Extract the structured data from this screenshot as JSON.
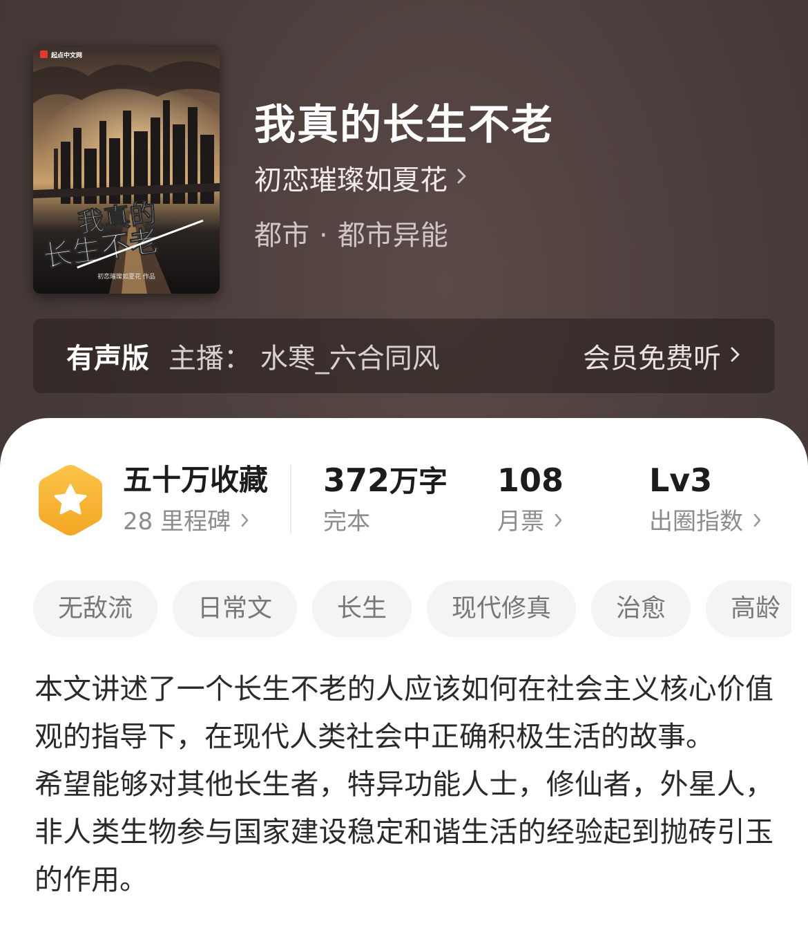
{
  "book": {
    "title": "我真的长生不老",
    "author": "初恋璀璨如夏花",
    "genre": "都市",
    "subgenre": "都市异能",
    "genre_separator": "·",
    "cover": {
      "publisher_logo_text": "起点中文网",
      "cover_title_line1": "我真的",
      "cover_title_line2": "长生不老",
      "cover_author_credit": "初恋璀璨如夏花  作品"
    }
  },
  "audio": {
    "label": "有声版",
    "narrator": "主播：  水寒_六合同风",
    "cta": "会员免费听"
  },
  "stats": {
    "favorites": {
      "value": "五十万收藏",
      "label": "28 里程碑"
    },
    "words": {
      "value_number": "372",
      "value_unit": "万字",
      "label": "完本"
    },
    "monthly_tickets": {
      "value": "108",
      "label": "月票"
    },
    "index": {
      "value": "Lv3",
      "label": "出圈指数"
    }
  },
  "tags": [
    "无敌流",
    "日常文",
    "长生",
    "现代修真",
    "治愈",
    "高龄"
  ],
  "synopsis": [
    "本文讲述了一个长生不老的人应该如何在社会主义核心价值观的指导下，在现代人类社会中正确积极生活的故事。",
    "希望能够对其他长生者，特异功能人士，修仙者，外星人，非人类生物参与国家建设稳定和谐生活的经验起到抛砖引玉的作用。"
  ],
  "colors": {
    "header_bg": "#4a3d3b",
    "badge_orange": "#f5a623",
    "badge_yellow": "#fbc44a",
    "tag_bg": "#f4f4f4",
    "muted_text": "#8c8c8c"
  },
  "icons": {
    "author_arrow": "chevron-right-icon",
    "audio_arrow": "chevron-right-icon",
    "badge": "star-hexagon-icon"
  }
}
